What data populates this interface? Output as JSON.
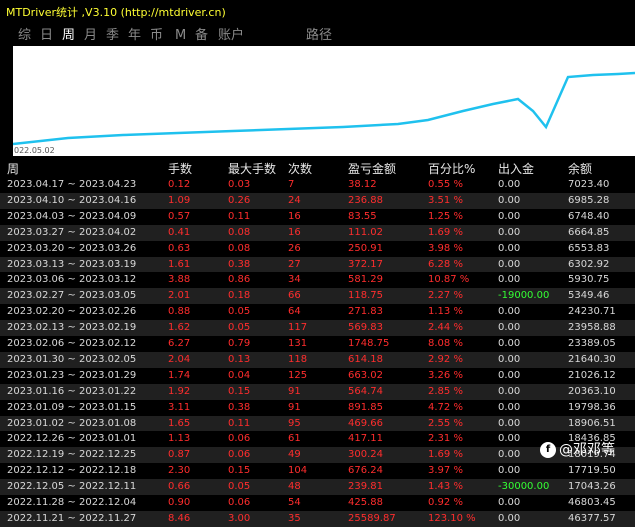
{
  "app": {
    "title": "MTDriver统计 ,V3.10 (http://mtdriver.cn)"
  },
  "tabs": [
    {
      "label": "综",
      "name": "tab-summary"
    },
    {
      "label": "日",
      "name": "tab-day"
    },
    {
      "label": "周",
      "name": "tab-week",
      "active": true
    },
    {
      "label": "月",
      "name": "tab-month"
    },
    {
      "label": "季",
      "name": "tab-quarter"
    },
    {
      "label": "年",
      "name": "tab-year"
    },
    {
      "label": "币",
      "name": "tab-currency"
    },
    {
      "label": "M",
      "name": "tab-magic"
    },
    {
      "label": "备",
      "name": "tab-note"
    },
    {
      "label": "账户",
      "name": "tab-account"
    },
    {
      "label": "路径",
      "name": "tab-path"
    }
  ],
  "chart": {
    "date_label": "022.05.02",
    "line_color": "#1fc1ee"
  },
  "table": {
    "headers": [
      "周",
      "手数",
      "最大手数",
      "次数",
      "盈亏金额",
      "百分比%",
      "出入金",
      "余额"
    ],
    "rows": [
      [
        "2023.04.17 ~ 2023.04.23",
        "0.12",
        "0.03",
        "7",
        "38.12",
        "0.55 %",
        "0.00",
        "7023.40"
      ],
      [
        "2023.04.10 ~ 2023.04.16",
        "1.09",
        "0.26",
        "24",
        "236.88",
        "3.51 %",
        "0.00",
        "6985.28"
      ],
      [
        "2023.04.03 ~ 2023.04.09",
        "0.57",
        "0.11",
        "16",
        "83.55",
        "1.25 %",
        "0.00",
        "6748.40"
      ],
      [
        "2023.03.27 ~ 2023.04.02",
        "0.41",
        "0.08",
        "16",
        "111.02",
        "1.69 %",
        "0.00",
        "6664.85"
      ],
      [
        "2023.03.20 ~ 2023.03.26",
        "0.63",
        "0.08",
        "26",
        "250.91",
        "3.98 %",
        "0.00",
        "6553.83"
      ],
      [
        "2023.03.13 ~ 2023.03.19",
        "1.61",
        "0.38",
        "27",
        "372.17",
        "6.28 %",
        "0.00",
        "6302.92"
      ],
      [
        "2023.03.06 ~ 2023.03.12",
        "3.88",
        "0.86",
        "34",
        "581.29",
        "10.87 %",
        "0.00",
        "5930.75"
      ],
      [
        "2023.02.27 ~ 2023.03.05",
        "2.01",
        "0.18",
        "66",
        "118.75",
        "2.27 %",
        "-19000.00",
        "5349.46"
      ],
      [
        "2023.02.20 ~ 2023.02.26",
        "0.88",
        "0.05",
        "64",
        "271.83",
        "1.13 %",
        "0.00",
        "24230.71"
      ],
      [
        "2023.02.13 ~ 2023.02.19",
        "1.62",
        "0.05",
        "117",
        "569.83",
        "2.44 %",
        "0.00",
        "23958.88"
      ],
      [
        "2023.02.06 ~ 2023.02.12",
        "6.27",
        "0.79",
        "131",
        "1748.75",
        "8.08 %",
        "0.00",
        "23389.05"
      ],
      [
        "2023.01.30 ~ 2023.02.05",
        "2.04",
        "0.13",
        "118",
        "614.18",
        "2.92 %",
        "0.00",
        "21640.30"
      ],
      [
        "2023.01.23 ~ 2023.01.29",
        "1.74",
        "0.04",
        "125",
        "663.02",
        "3.26 %",
        "0.00",
        "21026.12"
      ],
      [
        "2023.01.16 ~ 2023.01.22",
        "1.92",
        "0.15",
        "91",
        "564.74",
        "2.85 %",
        "0.00",
        "20363.10"
      ],
      [
        "2023.01.09 ~ 2023.01.15",
        "3.11",
        "0.38",
        "91",
        "891.85",
        "4.72 %",
        "0.00",
        "19798.36"
      ],
      [
        "2023.01.02 ~ 2023.01.08",
        "1.65",
        "0.11",
        "95",
        "469.66",
        "2.55 %",
        "0.00",
        "18906.51"
      ],
      [
        "2022.12.26 ~ 2023.01.01",
        "1.13",
        "0.06",
        "61",
        "417.11",
        "2.31 %",
        "0.00",
        "18436.85"
      ],
      [
        "2022.12.19 ~ 2022.12.25",
        "0.87",
        "0.06",
        "49",
        "300.24",
        "1.69 %",
        "0.00",
        "18019.74"
      ],
      [
        "2022.12.12 ~ 2022.12.18",
        "2.30",
        "0.15",
        "104",
        "676.24",
        "3.97 %",
        "0.00",
        "17719.50"
      ],
      [
        "2022.12.05 ~ 2022.12.11",
        "0.66",
        "0.05",
        "48",
        "239.81",
        "1.43 %",
        "-30000.00",
        "17043.26"
      ],
      [
        "2022.11.28 ~ 2022.12.04",
        "0.90",
        "0.06",
        "54",
        "425.88",
        "0.92 %",
        "0.00",
        "46803.45"
      ],
      [
        "2022.11.21 ~ 2022.11.27",
        "8.46",
        "3.00",
        "35",
        "25589.87",
        "123.10 %",
        "0.00",
        "46377.57"
      ]
    ]
  },
  "watermark": {
    "icon": "f",
    "text": "@邓邓等"
  }
}
